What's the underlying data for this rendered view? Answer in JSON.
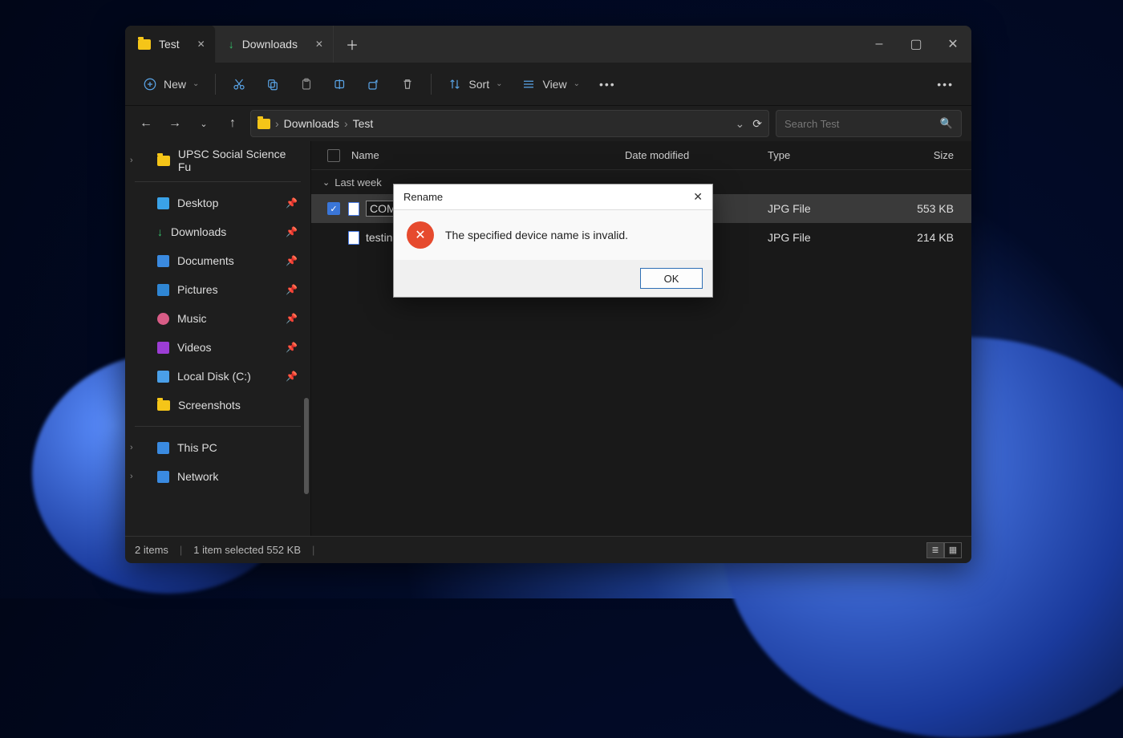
{
  "tabs": [
    {
      "label": "Test",
      "icon": "folder"
    },
    {
      "label": "Downloads",
      "icon": "download"
    }
  ],
  "window_controls": {
    "minimize": "–",
    "maximize": "▢",
    "close": "✕"
  },
  "toolbar": {
    "new_label": "New",
    "sort_label": "Sort",
    "view_label": "View"
  },
  "breadcrumb": {
    "segments": [
      "Downloads",
      "Test"
    ]
  },
  "search": {
    "placeholder": "Search Test"
  },
  "sidebar": {
    "top": [
      {
        "label": "UPSC Social Science Fu",
        "caret": true,
        "icon": "folder"
      }
    ],
    "quick": [
      {
        "label": "Desktop",
        "icon_color": "#3aa2e8",
        "pin": true
      },
      {
        "label": "Downloads",
        "icon": "download",
        "pin": true
      },
      {
        "label": "Documents",
        "icon_color": "#3a8ae0",
        "pin": true
      },
      {
        "label": "Pictures",
        "icon_color": "#2f86d4",
        "pin": true
      },
      {
        "label": "Music",
        "icon_color": "#d85c86",
        "pin": true
      },
      {
        "label": "Videos",
        "icon_color": "#9c3dd4",
        "pin": true
      },
      {
        "label": "Local Disk (C:)",
        "icon_color": "#4a9fe8",
        "pin": true
      },
      {
        "label": "Screenshots",
        "icon": "folder",
        "pin": false
      }
    ],
    "bottom": [
      {
        "label": "This PC",
        "caret": true,
        "icon_color": "#3a8ae0"
      },
      {
        "label": "Network",
        "caret": true,
        "icon_color": "#3a8ae0"
      }
    ]
  },
  "columns": {
    "name": "Name",
    "date": "Date modified",
    "type": "Type",
    "size": "Size"
  },
  "group_label": "Last week",
  "files": [
    {
      "selected": true,
      "editing": true,
      "name": "COM1",
      "type": "JPG File",
      "size": "553 KB"
    },
    {
      "selected": false,
      "editing": false,
      "name": "testing",
      "type": "JPG File",
      "size": "214 KB"
    }
  ],
  "status": {
    "items": "2 items",
    "selection": "1 item selected  552 KB"
  },
  "dialog": {
    "title": "Rename",
    "message": "The specified device name is invalid.",
    "ok_label": "OK"
  }
}
